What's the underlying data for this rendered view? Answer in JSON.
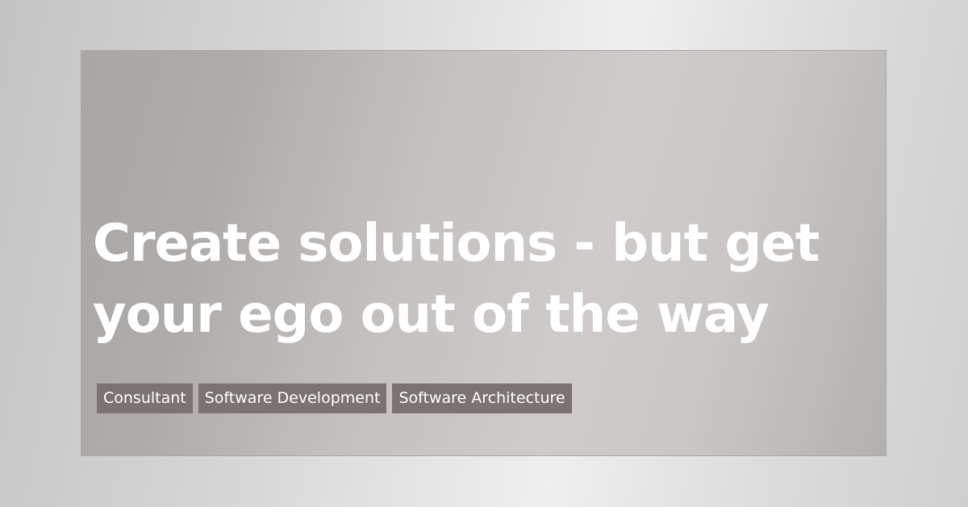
{
  "title_line1": "Create solutions - but get",
  "title_line2": "your ego out of the way",
  "tags": [
    "Consultant",
    "Software Development",
    "Software Architecture"
  ],
  "colors": {
    "title_text": "#ffffff",
    "tag_background": "#7a7371",
    "tag_text": "#ffffff"
  }
}
